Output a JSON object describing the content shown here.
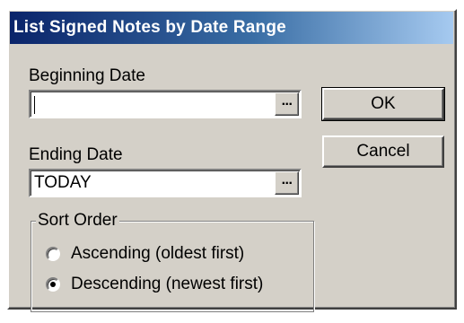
{
  "window": {
    "title": "List Signed Notes by Date Range"
  },
  "beginning_date": {
    "label": "Beginning Date",
    "value": "",
    "browse_button_label": "..."
  },
  "ending_date": {
    "label": "Ending Date",
    "value": "TODAY",
    "browse_button_label": "..."
  },
  "buttons": {
    "ok_label": "OK",
    "cancel_label": "Cancel"
  },
  "sort_order": {
    "legend": "Sort Order",
    "options": [
      {
        "label": "Ascending (oldest first)",
        "selected": false
      },
      {
        "label": "Descending (newest first)",
        "selected": true
      }
    ]
  },
  "colors": {
    "dialog_face": "#d4d0c8",
    "title_bar_start": "#0a246a",
    "title_bar_end": "#a6caf0",
    "title_text": "#ffffff"
  }
}
